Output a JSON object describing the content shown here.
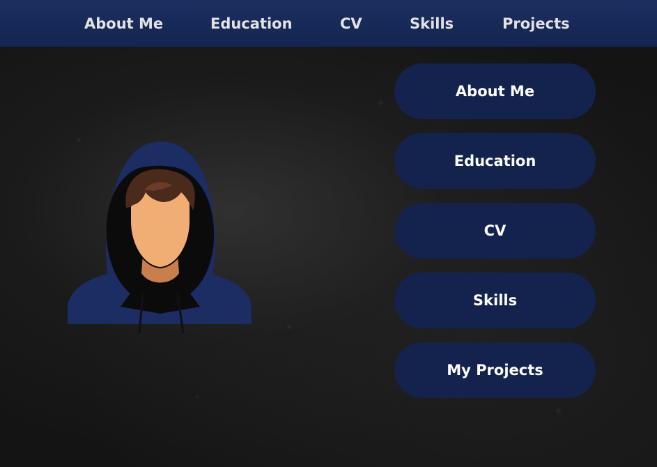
{
  "top_nav": {
    "items": [
      {
        "label": "About Me"
      },
      {
        "label": "Education"
      },
      {
        "label": "CV"
      },
      {
        "label": "Skills"
      },
      {
        "label": "Projects"
      }
    ]
  },
  "side_menu": {
    "items": [
      {
        "label": "About Me"
      },
      {
        "label": "Education"
      },
      {
        "label": "CV"
      },
      {
        "label": "Skills"
      },
      {
        "label": "My Projects"
      }
    ]
  },
  "avatar": {
    "icon": "hooded-person-avatar"
  },
  "colors": {
    "nav_bar": "#172a58",
    "pill_button": "#13234d",
    "background": "#141414",
    "nav_text": "#e3e3e3",
    "pill_text": "#ffffff"
  }
}
